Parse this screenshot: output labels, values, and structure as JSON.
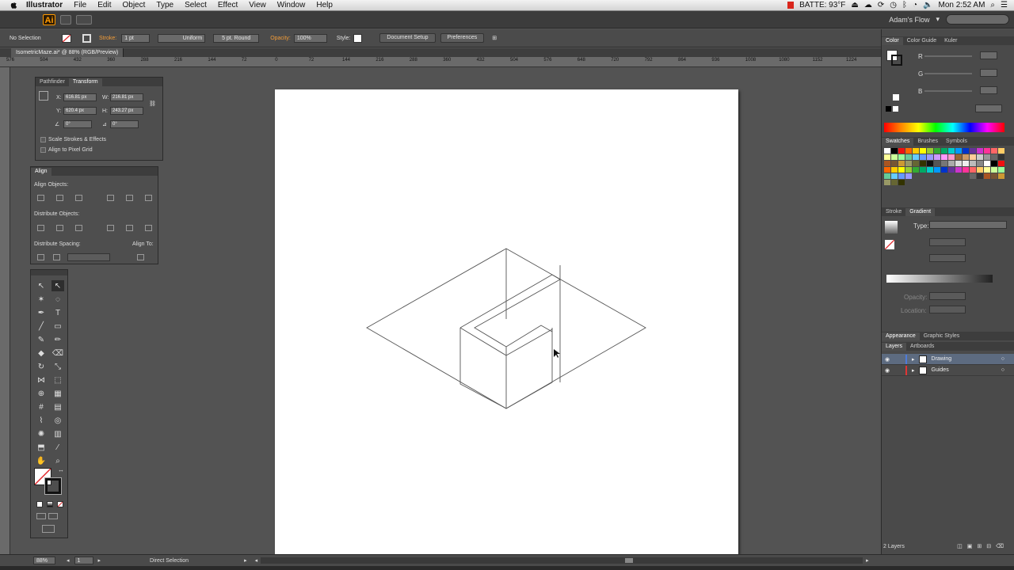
{
  "menubar": {
    "app": "Illustrator",
    "items": [
      "File",
      "Edit",
      "Object",
      "Type",
      "Select",
      "Effect",
      "View",
      "Window",
      "Help"
    ],
    "battery": "BATTE: 93°F",
    "clock": "Mon 2:52 AM"
  },
  "appbar": {
    "logo": "Ai",
    "workspace": "Adam's Flow"
  },
  "control": {
    "selection": "No Selection",
    "stroke_label": "Stroke:",
    "stroke_weight": "1 pt",
    "profile": "Uniform",
    "brush": "5 pt. Round",
    "opacity_label": "Opacity:",
    "opacity_value": "100%",
    "style_label": "Style:",
    "document_setup": "Document Setup",
    "preferences": "Preferences"
  },
  "document": {
    "tab": "IsometricMaze.ai* @ 88% (RGB/Preview)",
    "ruler_ticks": [
      "576",
      "504",
      "432",
      "360",
      "288",
      "216",
      "144",
      "72",
      "0",
      "72",
      "144",
      "216",
      "288",
      "360",
      "432",
      "504",
      "576",
      "648",
      "720",
      "792",
      "864",
      "936",
      "1008",
      "1080",
      "1152",
      "1224"
    ]
  },
  "transform": {
    "tabs": [
      "Pathfinder",
      "Transform"
    ],
    "x_label": "X:",
    "x": "616.81 px",
    "w_label": "W:",
    "w": "216.81 px",
    "y_label": "Y:",
    "y": "620.4 px",
    "h_label": "H:",
    "h": "243.27 px",
    "angle": "0°",
    "shear": "0°",
    "scale_strokes": "Scale Strokes & Effects",
    "align_pixel": "Align to Pixel Grid"
  },
  "align": {
    "title": "Align",
    "align_objects": "Align Objects:",
    "distribute_objects": "Distribute Objects:",
    "distribute_spacing": "Distribute Spacing:",
    "align_to": "Align To:"
  },
  "rightdock": {
    "color_tabs": [
      "Color",
      "Color Guide",
      "Kuler"
    ],
    "channels": [
      "R",
      "G",
      "B"
    ],
    "swatch_tabs": [
      "Swatches",
      "Brushes",
      "Symbols"
    ],
    "stroke_tabs": [
      "Stroke",
      "Gradient"
    ],
    "type_label": "Type:",
    "opacity_label": "Opacity:",
    "location_label": "Location:",
    "appearance_tabs": [
      "Appearance",
      "Graphic Styles"
    ],
    "layer_tabs": [
      "Layers",
      "Artboards"
    ],
    "layers": [
      {
        "name": "Drawing",
        "color": "#4f7bd8",
        "selected": true
      },
      {
        "name": "Guides",
        "color": "#e03535",
        "selected": false
      }
    ],
    "layers_count": "2 Layers"
  },
  "status": {
    "zoom": "88%",
    "page": "1",
    "tool": "Direct Selection"
  },
  "colors": {
    "accent_orange": "#ff9a00",
    "selection_blue": "#5d6b80",
    "ui_dark": "#4a4a4a",
    "canvas": "#535353"
  }
}
